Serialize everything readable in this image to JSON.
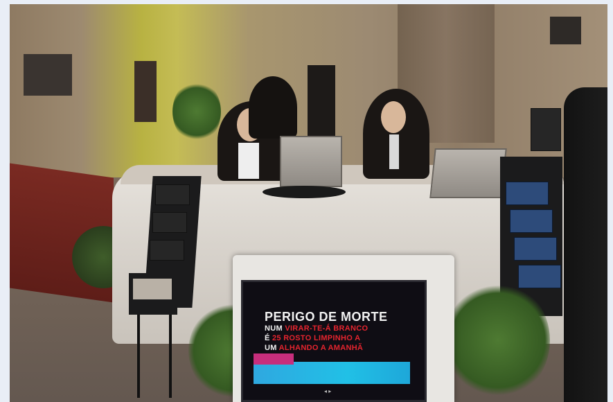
{
  "kiosk_screen": {
    "title": "PERIGO DE MORTE",
    "line1_prefix": "NUM",
    "line1_rest": "VIRAR-TE-Á BRANCO",
    "line2_prefix": "É",
    "line2_rest": "25 ROSTO LIMPINHO A",
    "line3_prefix": "UM",
    "line3_rest": "ALHANDO A AMANHÃ",
    "banner_label": "",
    "nav": "◂ ▸"
  },
  "colors": {
    "accent_red": "#e5242e",
    "banner_cyan": "#21c0e6",
    "banner_pink": "#c72e7c"
  }
}
